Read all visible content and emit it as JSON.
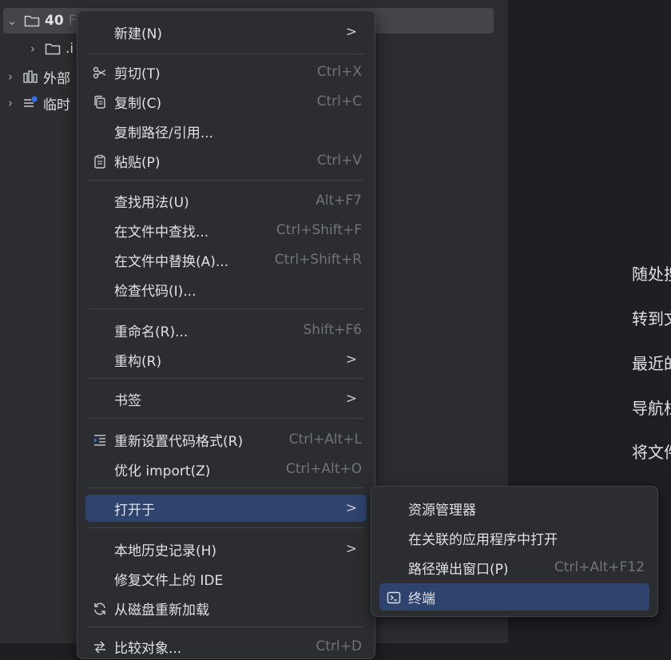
{
  "tree": {
    "root": {
      "name": "40",
      "suffix": "F"
    },
    "items": [
      {
        "label": ".i"
      },
      {
        "label": "外部"
      },
      {
        "label": "临时"
      }
    ]
  },
  "editor_tips": [
    "随处搜",
    "转到文",
    "最近的",
    "导航栏",
    "将文件"
  ],
  "context_menu": {
    "items": [
      {
        "label": "新建(N)",
        "submenu": ">"
      },
      {
        "label": "剪切(T)",
        "shortcut": "Ctrl+X",
        "icon": "scissors-icon"
      },
      {
        "label": "复制(C)",
        "shortcut": "Ctrl+C",
        "icon": "copy-icon"
      },
      {
        "label": "复制路径/引用..."
      },
      {
        "label": "粘贴(P)",
        "shortcut": "Ctrl+V",
        "icon": "paste-icon"
      },
      {
        "label": "查找用法(U)",
        "shortcut": "Alt+F7"
      },
      {
        "label": "在文件中查找...",
        "shortcut": "Ctrl+Shift+F"
      },
      {
        "label": "在文件中替换(A)...",
        "shortcut": "Ctrl+Shift+R"
      },
      {
        "label": "检查代码(I)..."
      },
      {
        "label": "重命名(R)...",
        "shortcut": "Shift+F6"
      },
      {
        "label": "重构(R)",
        "submenu": ">"
      },
      {
        "label": "书签",
        "submenu": ">"
      },
      {
        "label": "重新设置代码格式(R)",
        "shortcut": "Ctrl+Alt+L",
        "icon": "reformat-icon"
      },
      {
        "label": "优化 import(Z)",
        "shortcut": "Ctrl+Alt+O"
      },
      {
        "label": "打开于",
        "submenu": ">"
      },
      {
        "label": "本地历史记录(H)",
        "submenu": ">"
      },
      {
        "label": "修复文件上的 IDE"
      },
      {
        "label": "从磁盘重新加载",
        "icon": "reload-icon"
      },
      {
        "label": "比较对象...",
        "shortcut": "Ctrl+D",
        "icon": "compare-icon"
      }
    ]
  },
  "submenu": {
    "items": [
      {
        "label": "资源管理器"
      },
      {
        "label": "在关联的应用程序中打开"
      },
      {
        "label": "路径弹出窗口(P)",
        "shortcut": "Ctrl+Alt+F12"
      },
      {
        "label": "终端",
        "icon": "terminal-icon"
      }
    ]
  }
}
